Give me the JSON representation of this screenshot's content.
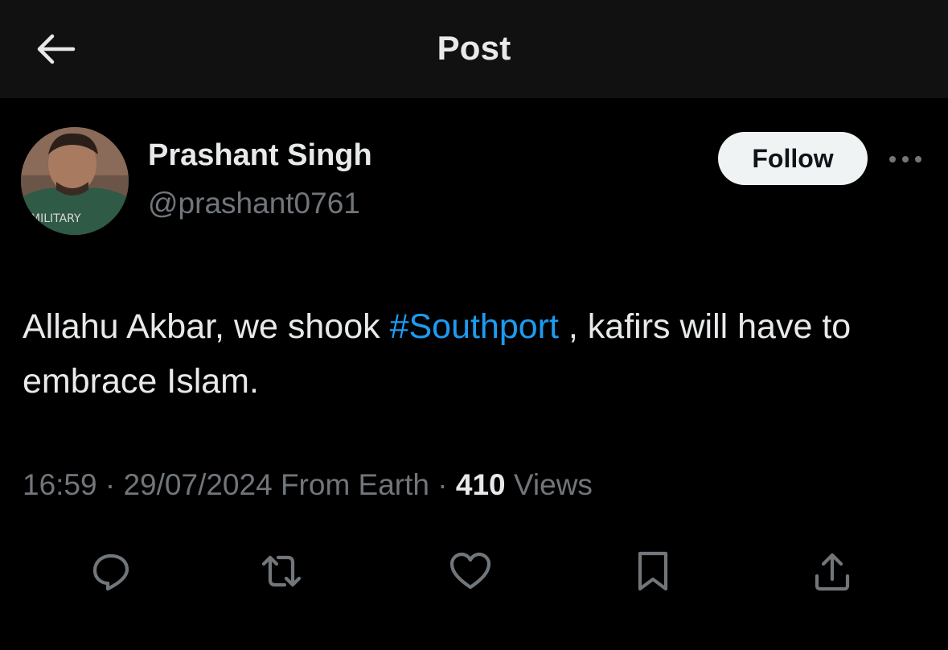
{
  "header": {
    "title": "Post",
    "back_icon": "arrow-left-icon"
  },
  "author": {
    "name": "Prashant Singh",
    "handle": "@prashant0761",
    "avatar_shirt_text": "MILITARY"
  },
  "follow": {
    "label": "Follow"
  },
  "more": {
    "icon": "more-horizontal-icon"
  },
  "post": {
    "text_before": "Allahu Akbar, we shook ",
    "hashtag": "#Southport",
    "text_after": " , kafirs will have to embrace Islam."
  },
  "meta": {
    "time": "16:59",
    "sep1": " · ",
    "date": "29/07/2024",
    "source": " From Earth",
    "sep2": " · ",
    "views_count": "410",
    "views_label": " Views"
  },
  "actions": [
    {
      "name": "reply",
      "icon": "reply-icon"
    },
    {
      "name": "repost",
      "icon": "repost-icon"
    },
    {
      "name": "like",
      "icon": "heart-icon"
    },
    {
      "name": "bookmark",
      "icon": "bookmark-icon"
    },
    {
      "name": "share",
      "icon": "share-icon"
    }
  ],
  "colors": {
    "background": "#000000",
    "header": "#111111",
    "text": "#e7e9ea",
    "muted": "#71767b",
    "link": "#1d9bf0",
    "follow_bg": "#eff3f4"
  }
}
